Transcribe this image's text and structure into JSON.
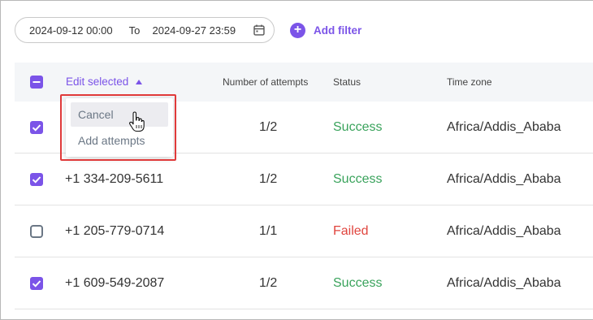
{
  "filter": {
    "from": "2024-09-12 00:00",
    "to_label": "To",
    "to": "2024-09-27 23:59",
    "calendar_icon": "calendar-icon",
    "add_filter_label": "Add filter"
  },
  "table": {
    "headers": {
      "edit_selected": "Edit selected",
      "attempts": "Number of attempts",
      "status": "Status",
      "timezone": "Time zone"
    },
    "rows": [
      {
        "checked": true,
        "phone": "",
        "attempts": "1/2",
        "status": "Success",
        "timezone": "Africa/Addis_Ababa"
      },
      {
        "checked": true,
        "phone": "+1 334-209-5611",
        "attempts": "1/2",
        "status": "Success",
        "timezone": "Africa/Addis_Ababa"
      },
      {
        "checked": false,
        "phone": "+1 205-779-0714",
        "attempts": "1/1",
        "status": "Failed",
        "timezone": "Africa/Addis_Ababa"
      },
      {
        "checked": true,
        "phone": "+1 609-549-2087",
        "attempts": "1/2",
        "status": "Success",
        "timezone": "Africa/Addis_Ababa"
      }
    ]
  },
  "dropdown": {
    "items": [
      "Cancel",
      "Add attempts"
    ]
  },
  "colors": {
    "accent": "#7b54e8",
    "success": "#3aa35c",
    "failed": "#e0453e",
    "highlight": "#e03a3a"
  }
}
